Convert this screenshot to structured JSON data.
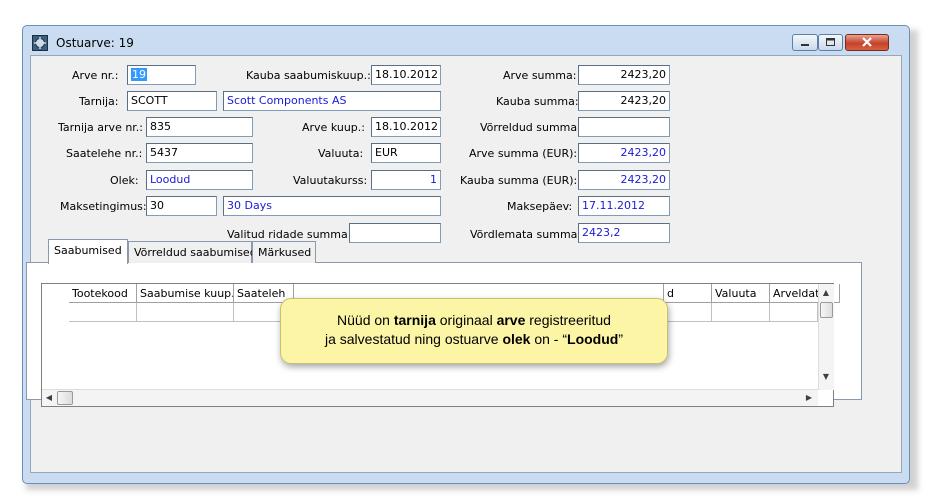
{
  "window": {
    "title": "Ostuarve: 19"
  },
  "form": {
    "arve_nr": {
      "label": "Arve nr.:",
      "value": "19"
    },
    "kauba_saabumiskuup": {
      "label": "Kauba saabumiskuup.:",
      "value": "18.10.2012"
    },
    "arve_summa": {
      "label": "Arve summa:",
      "value": "2423,20"
    },
    "tarnija": {
      "label": "Tarnija:",
      "code": "SCOTT",
      "name": "Scott Components AS"
    },
    "kauba_summa": {
      "label": "Kauba summa:",
      "value": "2423,20"
    },
    "tarnija_arve_nr": {
      "label": "Tarnija arve nr.:",
      "value": "835"
    },
    "arve_kuup": {
      "label": "Arve kuup.:",
      "value": "18.10.2012"
    },
    "vorreldud_summa": {
      "label": "Võrreldud summa:",
      "value": ""
    },
    "saatelehe_nr": {
      "label": "Saatelehe nr.:",
      "value": "5437"
    },
    "valuuta": {
      "label": "Valuuta:",
      "value": "EUR"
    },
    "arve_summa_eur": {
      "label": "Arve summa (EUR):",
      "value": "2423,20"
    },
    "olek": {
      "label": "Olek:",
      "value": "Loodud"
    },
    "valuutakurss": {
      "label": "Valuutakurss:",
      "value": "1"
    },
    "kauba_summa_eur": {
      "label": "Kauba summa (EUR):",
      "value": "2423,20"
    },
    "maksetingimus": {
      "label": "Maksetingimus:",
      "code": "30",
      "name": "30 Days"
    },
    "maksepaev": {
      "label": "Maksepäev:",
      "value": "17.11.2012"
    },
    "valitud_ridade_summa": {
      "label": "Valitud ridade summa:",
      "value": ""
    },
    "vordlemata_summa": {
      "label": "Võrdlemata summa:",
      "value": "2423,2"
    }
  },
  "tabs": [
    {
      "label": "Saabumised"
    },
    {
      "label": "Võrreldud saabumised"
    },
    {
      "label": "Märkused"
    }
  ],
  "grid": {
    "columns": [
      "Tootekood",
      "Saabumise kuup.",
      "Saateleh",
      "",
      "d",
      "Valuuta",
      "Arveldatud"
    ]
  },
  "callout": {
    "l1_a": "Nüüd on ",
    "l1_b": "tarnija",
    "l1_c": " originaal ",
    "l1_d": "arve",
    "l1_e": " registreeritud",
    "l2_a": "ja salvestatud ning ostuarve ",
    "l2_b": "olek",
    "l2_c": " on - “",
    "l2_d": "Loodud",
    "l2_e": "”"
  }
}
